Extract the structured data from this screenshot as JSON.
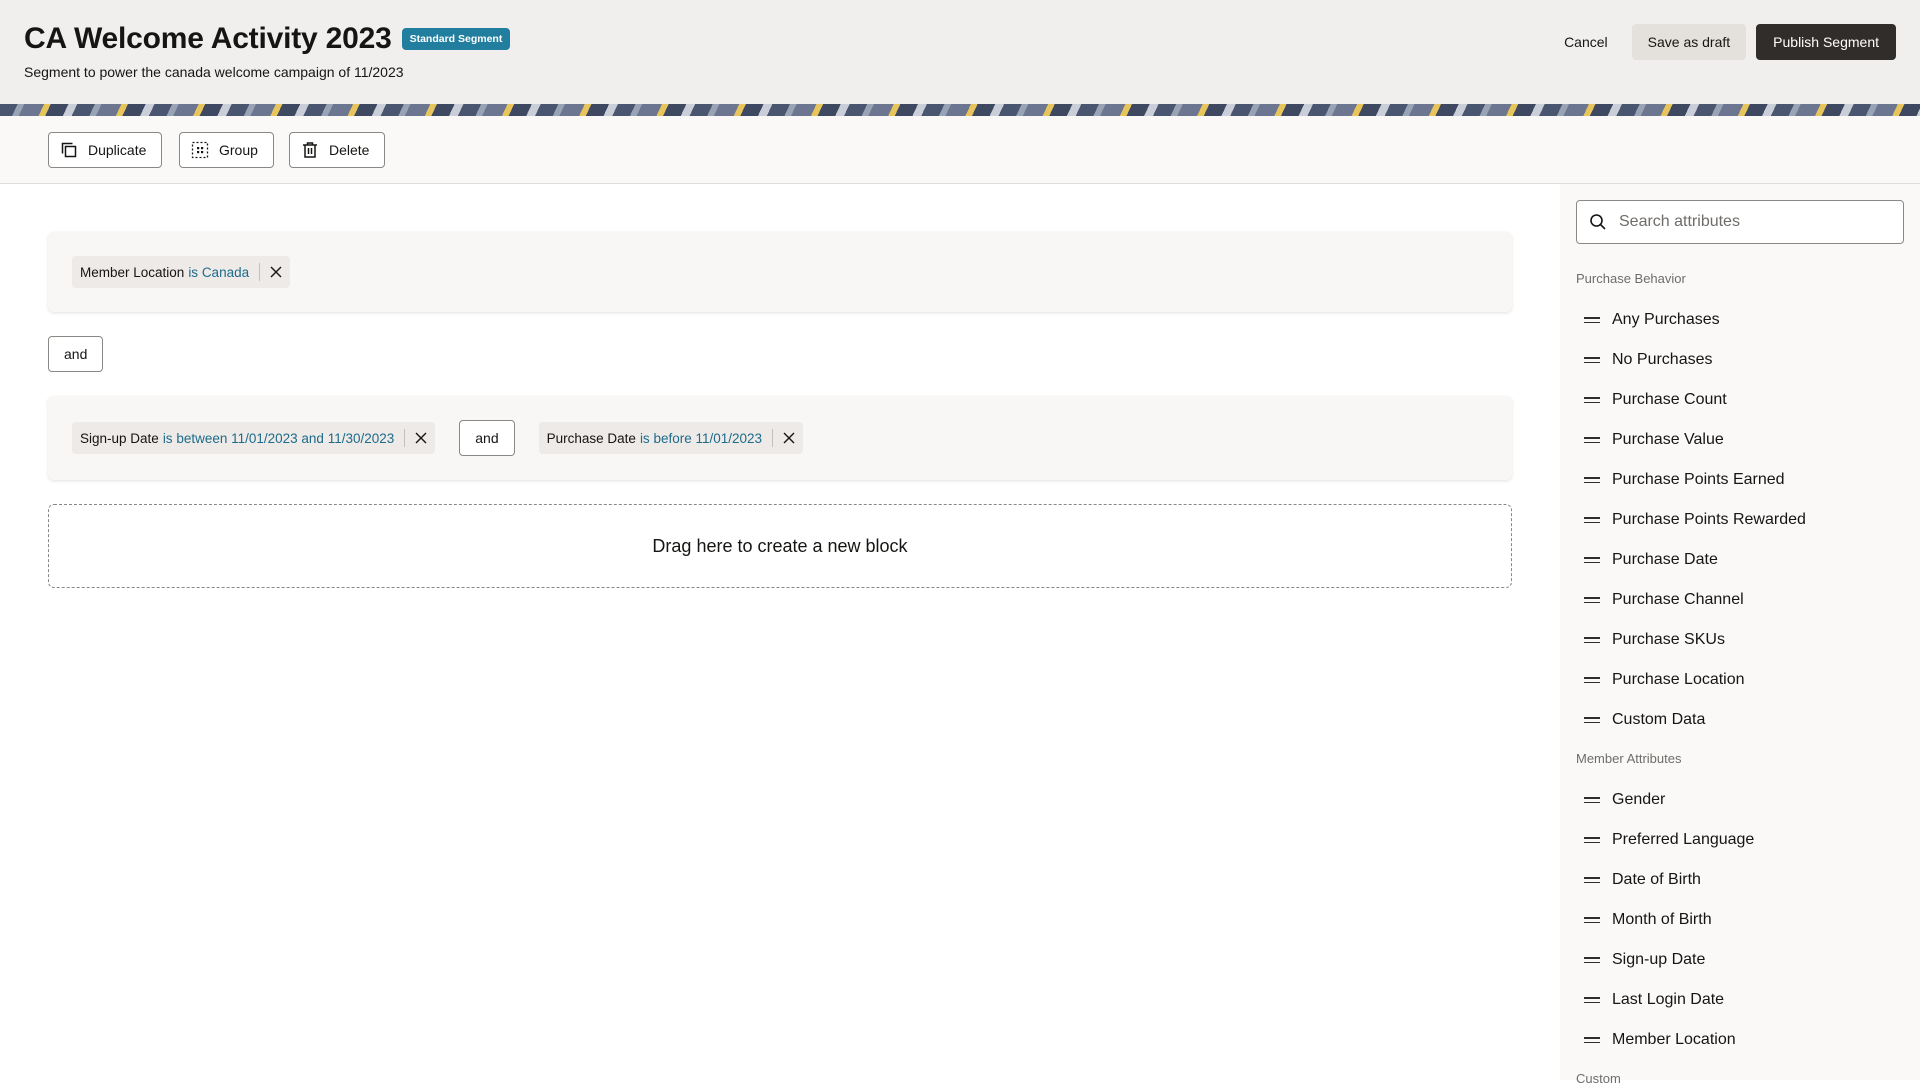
{
  "header": {
    "title": "CA Welcome Activity 2023",
    "badge": "Standard Segment",
    "subtitle": "Segment to power the canada welcome campaign of 11/2023",
    "cancel_label": "Cancel",
    "draft_label": "Save as draft",
    "publish_label": "Publish Segment"
  },
  "toolbar": {
    "duplicate_label": "Duplicate",
    "group_label": "Group",
    "delete_label": "Delete"
  },
  "canvas": {
    "block1": {
      "chip": {
        "attribute": "Member Location",
        "condition": "is Canada"
      }
    },
    "between_blocks_operator": "and",
    "block2": {
      "chip1": {
        "attribute": "Sign-up Date",
        "condition": "is between 11/01/2023 and 11/30/2023"
      },
      "operator": "and",
      "chip2": {
        "attribute": "Purchase Date",
        "condition": "is before 11/01/2023"
      }
    },
    "dropzone_label": "Drag here to create a new block"
  },
  "sidebar": {
    "search_placeholder": "Search attributes",
    "sections": [
      {
        "title": "Purchase Behavior",
        "items": [
          "Any Purchases",
          "No Purchases",
          "Purchase Count",
          "Purchase Value",
          "Purchase Points Earned",
          "Purchase Points Rewarded",
          "Purchase Date",
          "Purchase Channel",
          "Purchase SKUs",
          "Purchase Location",
          "Custom Data"
        ]
      },
      {
        "title": "Member Attributes",
        "items": [
          "Gender",
          "Preferred Language",
          "Date of Birth",
          "Month of Birth",
          "Sign-up Date",
          "Last Login Date",
          "Member Location"
        ]
      },
      {
        "title": "Custom",
        "items": []
      }
    ]
  },
  "colors": {
    "accent": "#227e9e",
    "condition_text": "#1e6b8a",
    "primary_button": "#312d2a",
    "header_bg": "#f1efed"
  }
}
